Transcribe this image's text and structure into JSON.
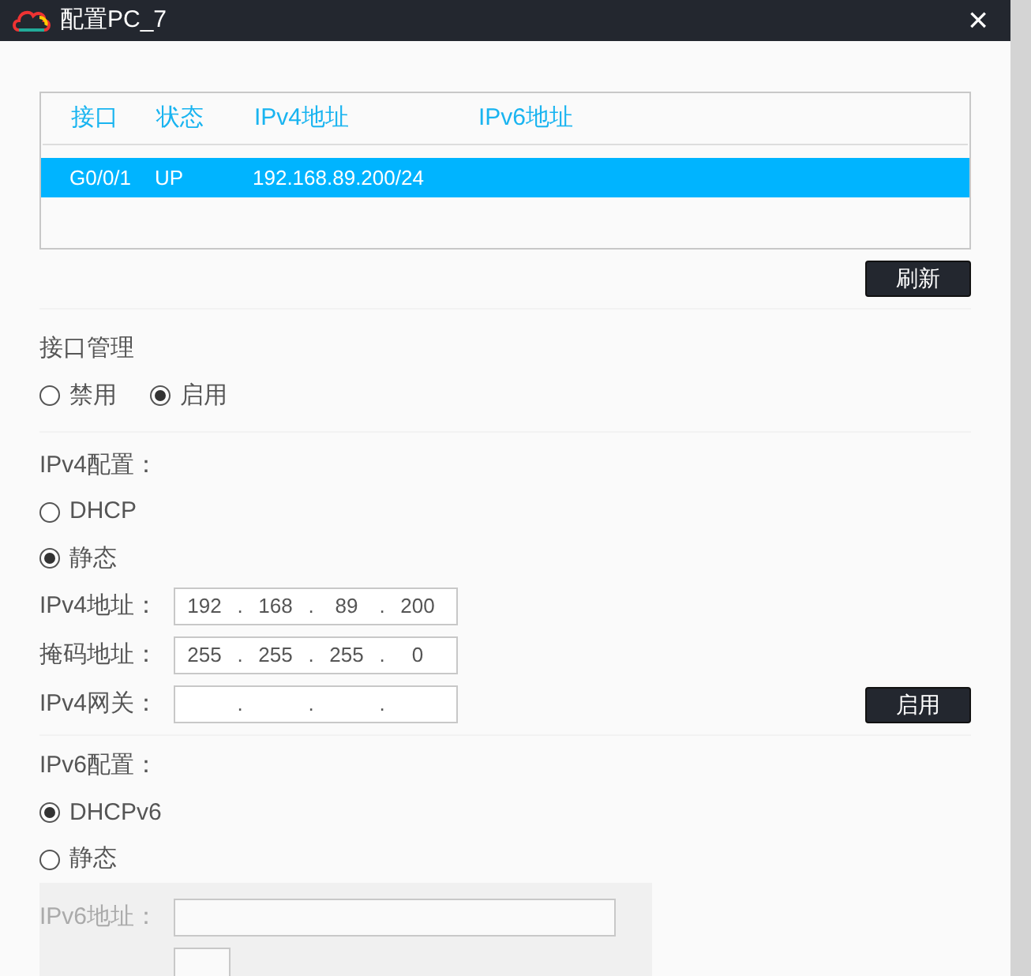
{
  "window": {
    "title": "配置PC_7",
    "close": "×"
  },
  "interface_table": {
    "columns": [
      "接口",
      "状态",
      "IPv4地址",
      "IPv6地址"
    ],
    "rows": [
      {
        "cells": [
          "G0/0/1",
          "UP",
          "192.168.89.200/24"
        ],
        "selected": true
      }
    ]
  },
  "refresh_button": "刷新",
  "interface_management": {
    "title": "接口管理",
    "options": [
      {
        "label": "禁用",
        "selected": false
      },
      {
        "label": "启用",
        "selected": true
      }
    ]
  },
  "ipv4": {
    "title": "IPv4配置：",
    "modes": [
      {
        "label": "DHCP",
        "selected": false
      },
      {
        "label": "静态",
        "selected": true
      }
    ],
    "separator": ".",
    "fields": [
      {
        "label": "IPv4地址：",
        "octets": [
          "192",
          "168",
          "89",
          "200"
        ]
      },
      {
        "label": "掩码地址：",
        "octets": [
          "255",
          "255",
          "255",
          "0"
        ]
      },
      {
        "label": "IPv4网关："
      }
    ],
    "apply_button": "启用"
  },
  "ipv6": {
    "title": "IPv6配置：",
    "modes": [
      {
        "label": "DHCPv6",
        "selected": true
      },
      {
        "label": "静态",
        "selected": false
      }
    ],
    "fields": [
      {
        "kind": "address",
        "label": "IPv6地址：",
        "disabled": true
      },
      {
        "kind": "prefix",
        "disabled": true
      }
    ]
  }
}
